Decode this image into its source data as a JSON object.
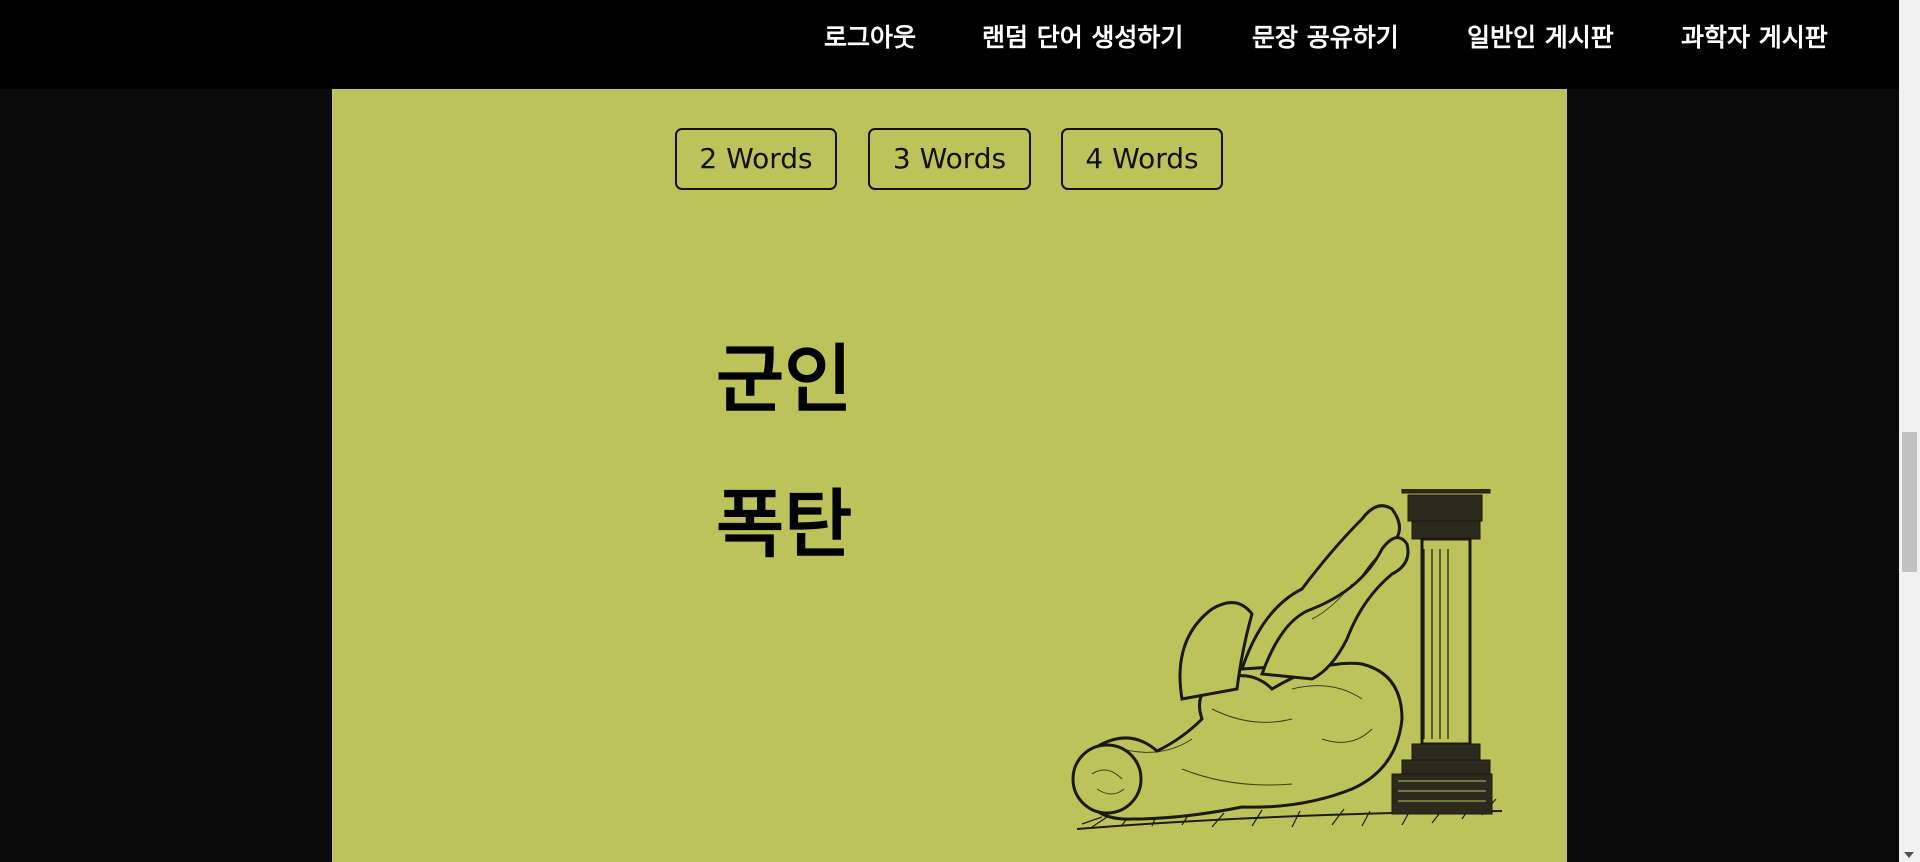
{
  "nav": {
    "items": [
      {
        "label": "로그아웃"
      },
      {
        "label": "랜덤 단어 생성하기"
      },
      {
        "label": "문장 공유하기"
      },
      {
        "label": "일반인 게시판"
      },
      {
        "label": "과학자 게시판"
      }
    ]
  },
  "word_count_buttons": [
    {
      "label": "2 Words"
    },
    {
      "label": "3 Words"
    },
    {
      "label": "4 Words"
    }
  ],
  "generated_words": [
    "군인",
    "폭탄"
  ],
  "illustration": {
    "icon": "fallen-man-with-pillar-illustration"
  },
  "colors": {
    "nav_bg": "#000000",
    "page_bg": "#0b0a0b",
    "panel_bg": "#bdc35a",
    "text": "#000000"
  }
}
